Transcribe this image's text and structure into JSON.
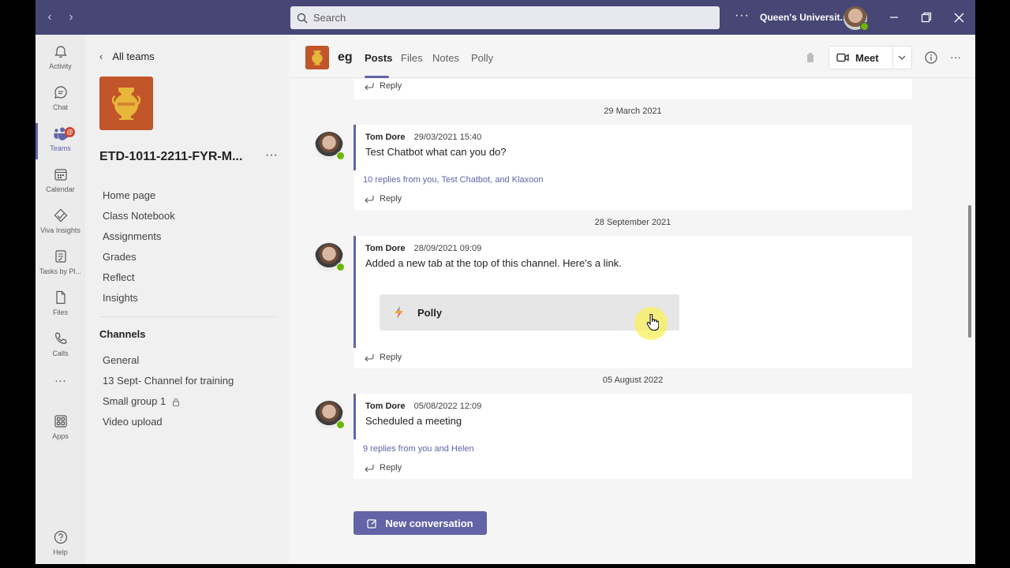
{
  "titlebar": {
    "search_placeholder": "Search",
    "more": "···",
    "org_name": "Queen's Universit..."
  },
  "rail": {
    "items": [
      {
        "label": "Activity",
        "icon": "bell-icon"
      },
      {
        "label": "Chat",
        "icon": "chat-icon"
      },
      {
        "label": "Teams",
        "icon": "teams-icon",
        "badge": "@"
      },
      {
        "label": "Calendar",
        "icon": "calendar-icon"
      },
      {
        "label": "Viva Insights",
        "icon": "insights-icon"
      },
      {
        "label": "Tasks by Pl...",
        "icon": "tasks-icon"
      },
      {
        "label": "Files",
        "icon": "file-icon"
      },
      {
        "label": "Calls",
        "icon": "phone-icon"
      },
      {
        "label": "···",
        "icon": "more-icon"
      },
      {
        "label": "Apps",
        "icon": "apps-icon"
      },
      {
        "label": "Help",
        "icon": "help-icon"
      }
    ]
  },
  "team_panel": {
    "back_label": "All teams",
    "team_name": "ETD-1011-2211-FYR-M...",
    "more": "···",
    "links": [
      "Home page",
      "Class Notebook",
      "Assignments",
      "Grades",
      "Reflect",
      "Insights"
    ],
    "channels_heading": "Channels",
    "channels": [
      "General",
      "13 Sept- Channel for training",
      "Small group 1",
      "Video upload"
    ]
  },
  "header": {
    "channel_name": "eg",
    "tabs": [
      "Posts",
      "Files",
      "Notes",
      "Polly"
    ],
    "active_tab": "Posts",
    "meet_label": "Meet"
  },
  "feed": {
    "top_reply": "Reply",
    "posts": [
      {
        "date": "29 March 2021",
        "author": "Tom Dore",
        "time": "29/03/2021 15:40",
        "body": "Test Chatbot what can you do?",
        "replies_summary": "10 replies from you, Test Chatbot, and Klaxoon",
        "reply": "Reply"
      },
      {
        "date": "28 September 2021",
        "author": "Tom Dore",
        "time": "28/09/2021 09:09",
        "body": "Added a new tab at the top of this channel. Here's a link.",
        "link_card": "Polly",
        "reply": "Reply"
      },
      {
        "date": "05 August 2022",
        "author": "Tom Dore",
        "time": "05/08/2022 12:09",
        "body": "Scheduled a meeting",
        "replies_summary": "9 replies from you and Helen",
        "reply": "Reply"
      }
    ],
    "new_conversation": "New conversation"
  },
  "colors": {
    "titlebar": "#464775",
    "accent": "#6264a7",
    "team_logo": "#c0562a",
    "badge": "#cc4a31",
    "presence": "#6bb700"
  }
}
